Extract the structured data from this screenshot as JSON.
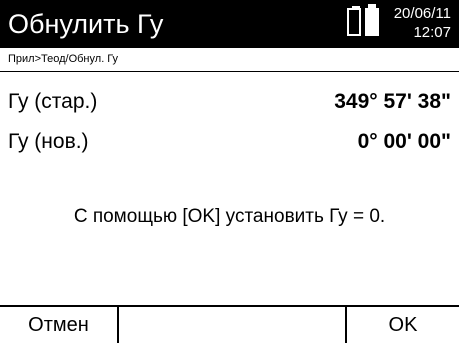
{
  "header": {
    "title": "Обнулить Гу",
    "date": "20/06/11",
    "time": "12:07",
    "battery_icons": [
      "battery-empty-icon",
      "battery-full-icon"
    ]
  },
  "breadcrumb": "Прил>Теод/Обнул. Гу",
  "rows": [
    {
      "label": "Гу (стар.)",
      "value": "349° 57' 38\""
    },
    {
      "label": "Гу (нов.)",
      "value": "0° 00' 00\""
    }
  ],
  "message": "С помощью [OK] установить Гу = 0.",
  "softkeys": {
    "left": "Отмен",
    "middle": "",
    "right": "OK"
  }
}
